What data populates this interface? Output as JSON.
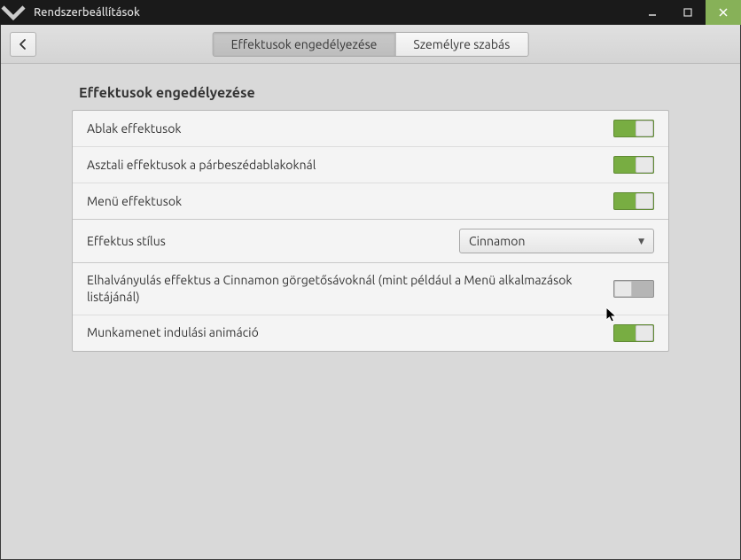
{
  "window": {
    "title": "Rendszerbeállítások"
  },
  "tabs": {
    "enable": "Effektusok engedélyezése",
    "customize": "Személyre szabás"
  },
  "section": {
    "title": "Effektusok engedélyezése"
  },
  "rows": {
    "window_effects": "Ablak effektusok",
    "dialog_effects": "Asztali effektusok a párbeszédablakoknál",
    "menu_effects": "Menü effektusok",
    "effect_style": "Effektus stílus",
    "fade_scroll": "Elhalványulás effektus a Cinnamon görgetősávoknál (mint például a Menü alkalmazások listájánál)",
    "startup_anim": "Munkamenet indulási animáció"
  },
  "combo": {
    "effect_style_value": "Cinnamon"
  },
  "switches": {
    "window_effects": true,
    "dialog_effects": true,
    "menu_effects": true,
    "fade_scroll": false,
    "startup_anim": true
  }
}
